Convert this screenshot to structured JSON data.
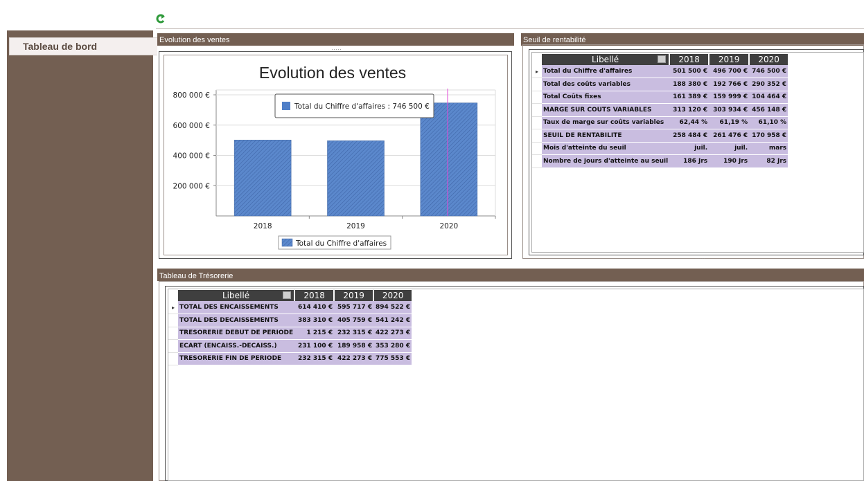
{
  "sidebar": {
    "items": [
      {
        "label": "Tableau de bord"
      }
    ]
  },
  "toolbar": {
    "refresh_icon": "refresh-icon"
  },
  "sales_panel": {
    "title": "Evolution des ventes",
    "chart_title": "Evolution des ventes",
    "tooltip": "Total du Chiffre d'affaires : 746 500 €",
    "legend": "Total du Chiffre d'affaires",
    "y_ticks": [
      "800 000 €",
      "600 000 €",
      "400 000 €",
      "200 000 €"
    ],
    "bar_color": "#4f7fc8"
  },
  "chart_data": {
    "type": "bar",
    "title": "Evolution des ventes",
    "categories": [
      "2018",
      "2019",
      "2020"
    ],
    "series": [
      {
        "name": "Total du Chiffre d'affaires",
        "values": [
          501500,
          496700,
          746500
        ]
      }
    ],
    "ylim": [
      0,
      800000
    ],
    "grid": true,
    "legend_position": "bottom"
  },
  "seuil_panel": {
    "title": "Seuil de rentabilité",
    "headers": [
      "Libellé",
      "2018",
      "2019",
      "2020"
    ],
    "rows": [
      [
        "Total du Chiffre d'affaires",
        "501 500 €",
        "496 700 €",
        "746 500 €"
      ],
      [
        "Total des coûts variables",
        "188 380 €",
        "192 766 €",
        "290 352 €"
      ],
      [
        "Total Coûts fixes",
        "161 389 €",
        "159 999 €",
        "104 464 €"
      ],
      [
        "MARGE SUR COUTS VARIABLES",
        "313 120 €",
        "303 934 €",
        "456 148 €"
      ],
      [
        "Taux de marge sur coûts variables",
        "62,44 %",
        "61,19 %",
        "61,10 %"
      ],
      [
        "SEUIL DE RENTABILITE",
        "258 484 €",
        "261 476 €",
        "170 958 €"
      ],
      [
        "Mois d'atteinte du seuil",
        "juil.",
        "juil.",
        "mars"
      ],
      [
        "Nombre de jours d'atteinte au seuil",
        "186 Jrs",
        "190 Jrs",
        "82 Jrs"
      ]
    ]
  },
  "tresorerie_panel": {
    "title": "Tableau de Trésorerie",
    "headers": [
      "Libellé",
      "2018",
      "2019",
      "2020"
    ],
    "rows": [
      [
        "TOTAL DES ENCAISSEMENTS",
        "614 410 €",
        "595 717 €",
        "894 522 €"
      ],
      [
        "TOTAL DES DECAISSEMENTS",
        "383 310 €",
        "405 759 €",
        "541 242 €"
      ],
      [
        "TRESORERIE DEBUT DE PERIODE",
        "1 215 €",
        "232 315 €",
        "422 273 €"
      ],
      [
        "ECART (ENCAISS.-DECAISS.)",
        "231 100 €",
        "189 958 €",
        "353 280 €"
      ],
      [
        "TRESORERIE FIN DE PERIODE",
        "232 315 €",
        "422 273 €",
        "775 553 €"
      ]
    ]
  }
}
